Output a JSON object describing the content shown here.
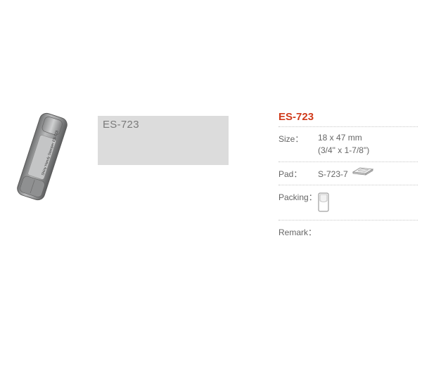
{
  "sample": {
    "text": "ES-723"
  },
  "product": {
    "model": "ES-723",
    "stamp_body_text": "Shiny Handy Stamper ES-723"
  },
  "specs": {
    "size_label": "Size：",
    "size_value_mm": "18 x 47 mm",
    "size_value_in": "(3/4\" x 1-7/8\")",
    "pad_label": "Pad：",
    "pad_value": "S-723-7",
    "pad_icon": "ink-pad-icon",
    "packing_label": "Packing：",
    "packing_icon": "packing-box-icon",
    "remark_label": "Remark："
  },
  "colors": {
    "title": "#d03a1a",
    "sample_bg": "#dcdcdc"
  }
}
